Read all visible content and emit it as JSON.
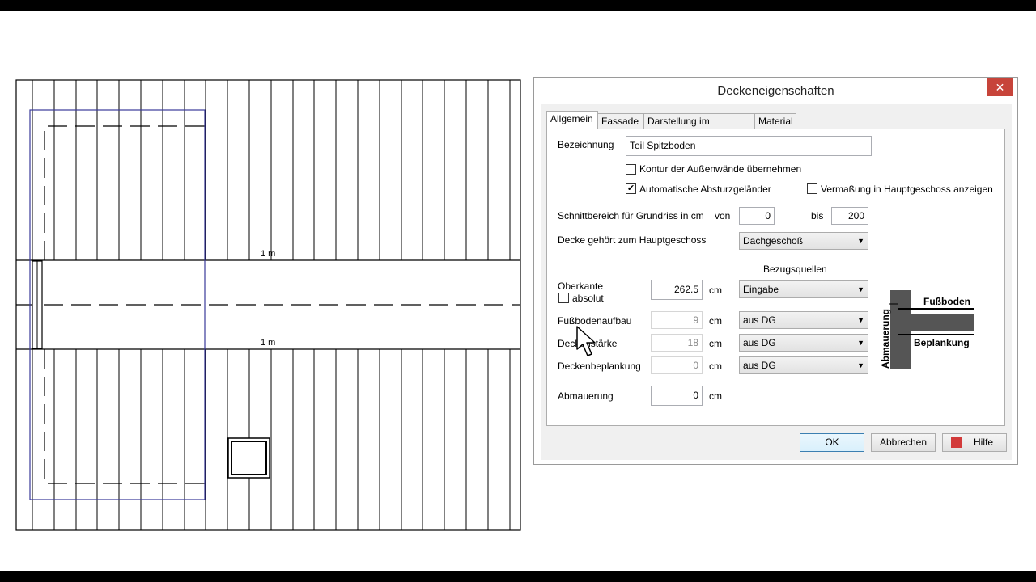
{
  "plan": {
    "scale_label_top": "1 m",
    "scale_label_bottom": "1 m"
  },
  "dialog": {
    "title": "Deckeneigenschaften",
    "close_label": "✕",
    "tabs": [
      {
        "label": "Allgemein",
        "active": true
      },
      {
        "label": "Fassade",
        "active": false
      },
      {
        "label": "Darstellung im Grundriss",
        "active": false
      },
      {
        "label": "Material",
        "active": false
      }
    ],
    "bezeichnung": {
      "label": "Bezeichnung",
      "value": "Teil Spitzboden"
    },
    "checkbox_kontur": {
      "label": "Kontur der Außenwände übernehmen",
      "checked": false
    },
    "checkbox_absturz": {
      "label": "Automatische Absturzgeländer",
      "checked": true
    },
    "checkbox_vermassung": {
      "label": "Vermaßung in Hauptgeschoss anzeigen",
      "checked": false
    },
    "schnitt": {
      "label": "Schnittbereich für Grundriss in cm",
      "von_label": "von",
      "von_value": "0",
      "bis_label": "bis",
      "bis_value": "200"
    },
    "hauptgeschoss": {
      "label": "Decke gehört zum Hauptgeschoss",
      "value": "Dachgeschoß"
    },
    "bezugsquellen_label": "Bezugsquellen",
    "oberkante": {
      "label": "Oberkante",
      "value": "262.5",
      "unit": "cm",
      "source": "Eingabe",
      "absolut_label": "absolut",
      "absolut_checked": false
    },
    "fussbodenaufbau": {
      "label": "Fußbodenaufbau",
      "value": "9",
      "unit": "cm",
      "source": "aus DG"
    },
    "deckenstaerke": {
      "label": "Deckenstärke",
      "value": "18",
      "unit": "cm",
      "source": "aus DG"
    },
    "deckenbeplankung": {
      "label": "Deckenbeplankung",
      "value": "0",
      "unit": "cm",
      "source": "aus DG"
    },
    "abmauerung": {
      "label": "Abmauerung",
      "value": "0",
      "unit": "cm"
    },
    "diagram": {
      "fussboden": "Fußboden",
      "beplankung": "Beplankung",
      "abmauerung": "Abmauerung"
    },
    "buttons": {
      "ok": "OK",
      "cancel": "Abbrechen",
      "help": "Hilfe"
    }
  },
  "colors": {
    "selection_outline": "#3a3a9a",
    "close_red": "#c7443a",
    "default_button_border": "#3c7fb1"
  }
}
